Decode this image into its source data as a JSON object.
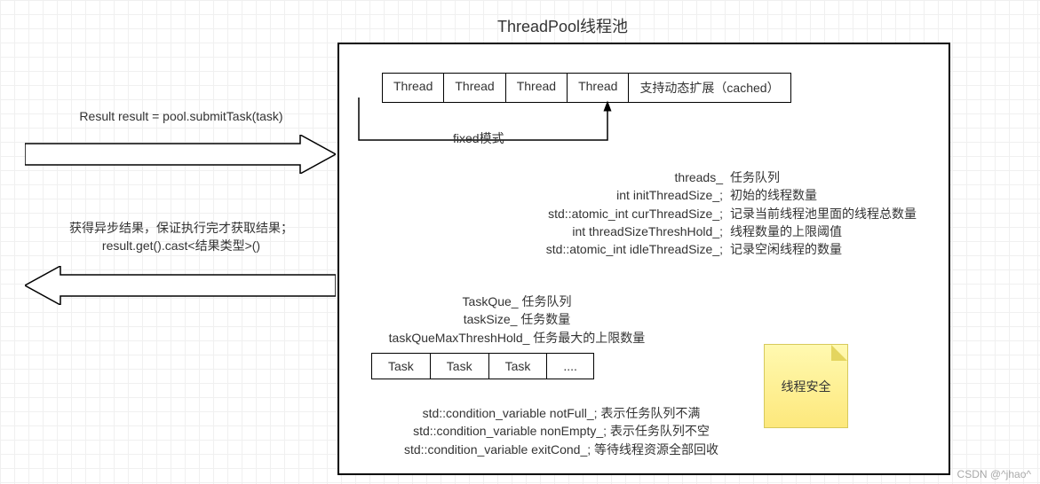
{
  "title": "ThreadPool线程池",
  "thread_cells": {
    "t0": "Thread",
    "t1": "Thread",
    "t2": "Thread",
    "t3": "Thread",
    "ext": "支持动态扩展（cached）"
  },
  "fixed_label": "fixed模式",
  "members": {
    "r0": {
      "var": "threads_",
      "desc": "任务队列"
    },
    "r1": {
      "var": "int initThreadSize_;",
      "desc": "初始的线程数量"
    },
    "r2": {
      "var": "std::atomic_int curThreadSize_;",
      "desc": "记录当前线程池里面的线程总数量"
    },
    "r3": {
      "var": "int threadSizeThreshHold_;",
      "desc": "线程数量的上限阈值"
    },
    "r4": {
      "var": "std::atomic_int idleThreadSize_;",
      "desc": "记录空闲线程的数量"
    }
  },
  "task_meta": {
    "l0": "TaskQue_ 任务队列",
    "l1": "taskSize_ 任务数量",
    "l2": "taskQueMaxThreshHold_ 任务最大的上限数量"
  },
  "task_cells": {
    "c0": "Task",
    "c1": "Task",
    "c2": "Task",
    "c3": "...."
  },
  "cond": {
    "l0": "std::condition_variable notFull_;   表示任务队列不满",
    "l1": "std::condition_variable nonEmpty_; 表示任务队列不空",
    "l2": "std::condition_variable exitCond_;   等待线程资源全部回收"
  },
  "sticky": "线程安全",
  "left1": "Result result = pool.submitTask(task)",
  "left2a": "获得异步结果，保证执行完才获取结果；",
  "left2b": "result.get().cast<结果类型>()",
  "watermark": "CSDN @^jhao^"
}
